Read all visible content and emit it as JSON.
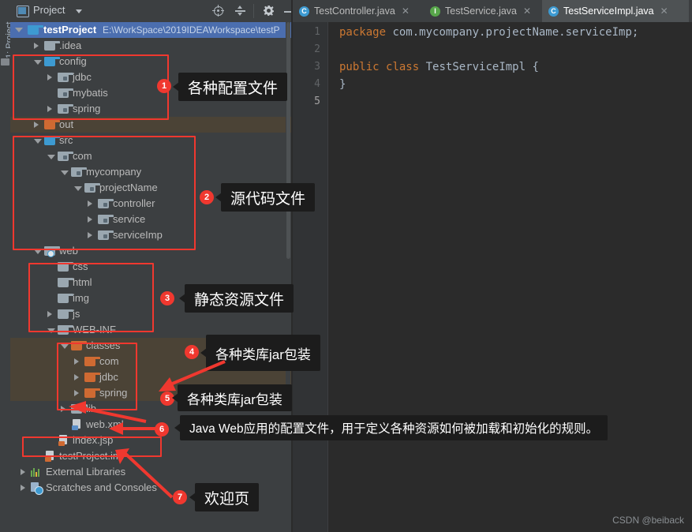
{
  "window": {
    "tool_strip_label": "1: Project"
  },
  "project_panel": {
    "title": "Project",
    "toolbar": [
      {
        "name": "locate-icon",
        "label": "Select Opened File"
      },
      {
        "name": "collapse-all-icon",
        "label": "Collapse All"
      },
      {
        "name": "gear-icon",
        "label": "Settings"
      },
      {
        "name": "minimize-icon",
        "label": "Hide"
      }
    ],
    "root": {
      "label": "testProject",
      "path": "E:\\WorkSpace\\2019IDEAWorkspace\\testP"
    },
    "tree": [
      {
        "label": ".idea",
        "depth": 1,
        "icon": "folder-gray",
        "arrow": "closed"
      },
      {
        "label": "config",
        "depth": 1,
        "icon": "folder-blue",
        "arrow": "open"
      },
      {
        "label": "jdbc",
        "depth": 2,
        "icon": "folder-package",
        "arrow": "closed"
      },
      {
        "label": "mybatis",
        "depth": 2,
        "icon": "folder-package",
        "arrow": "none"
      },
      {
        "label": "spring",
        "depth": 2,
        "icon": "folder-package",
        "arrow": "closed"
      },
      {
        "label": "out",
        "depth": 1,
        "icon": "folder-orange",
        "arrow": "closed"
      },
      {
        "label": "src",
        "depth": 1,
        "icon": "folder-blue",
        "arrow": "open"
      },
      {
        "label": "com",
        "depth": 2,
        "icon": "folder-package",
        "arrow": "open"
      },
      {
        "label": "mycompany",
        "depth": 3,
        "icon": "folder-package",
        "arrow": "open"
      },
      {
        "label": "projectName",
        "depth": 4,
        "icon": "folder-package",
        "arrow": "open"
      },
      {
        "label": "controller",
        "depth": 5,
        "icon": "folder-package",
        "arrow": "closed"
      },
      {
        "label": "service",
        "depth": 5,
        "icon": "folder-package",
        "arrow": "closed"
      },
      {
        "label": "serviceImp",
        "depth": 5,
        "icon": "folder-package",
        "arrow": "closed"
      },
      {
        "label": "web",
        "depth": 1,
        "icon": "folder-web",
        "arrow": "open"
      },
      {
        "label": "css",
        "depth": 2,
        "icon": "folder-gray",
        "arrow": "none"
      },
      {
        "label": "html",
        "depth": 2,
        "icon": "folder-gray",
        "arrow": "none"
      },
      {
        "label": "img",
        "depth": 2,
        "icon": "folder-gray",
        "arrow": "none"
      },
      {
        "label": "js",
        "depth": 2,
        "icon": "folder-gray",
        "arrow": "closed"
      },
      {
        "label": "WEB-INF",
        "depth": 2,
        "icon": "folder-gray",
        "arrow": "open"
      },
      {
        "label": "classes",
        "depth": 3,
        "icon": "folder-orange",
        "arrow": "open"
      },
      {
        "label": "com",
        "depth": 4,
        "icon": "folder-orange",
        "arrow": "closed"
      },
      {
        "label": "jdbc",
        "depth": 4,
        "icon": "folder-orange",
        "arrow": "closed"
      },
      {
        "label": "spring",
        "depth": 4,
        "icon": "folder-orange",
        "arrow": "closed"
      },
      {
        "label": "lib",
        "depth": 3,
        "icon": "folder-gray",
        "arrow": "closed"
      },
      {
        "label": "web.xml",
        "depth": 3,
        "icon": "file-xml",
        "arrow": "none"
      },
      {
        "label": "index.jsp",
        "depth": 2,
        "icon": "file-jsp",
        "arrow": "none"
      },
      {
        "label": "testProject.iml",
        "depth": 1,
        "icon": "file-iml",
        "arrow": "none"
      },
      {
        "label": "External Libraries",
        "depth": 0,
        "icon": "libraries",
        "arrow": "closed"
      },
      {
        "label": "Scratches and Consoles",
        "depth": 0,
        "icon": "scratches",
        "arrow": "closed"
      }
    ]
  },
  "annotations": {
    "accent_color": "#f0382f",
    "items": [
      {
        "number": "1",
        "text": "各种配置文件"
      },
      {
        "number": "2",
        "text": "源代码文件"
      },
      {
        "number": "3",
        "text": "静态资源文件"
      },
      {
        "number": "4",
        "text": "各种类库jar包装"
      },
      {
        "number": "5",
        "text": "各种类库jar包装"
      },
      {
        "number": "6",
        "text": "Java Web应用的配置文件，用于定义各种资源如何被加载和初始化的规则。"
      },
      {
        "number": "7",
        "text": "欢迎页"
      }
    ]
  },
  "editor": {
    "tabs": [
      {
        "label": "TestController.java",
        "icon": "class-icon",
        "icon_letter": "C",
        "active": false,
        "close": "✕"
      },
      {
        "label": "TestService.java",
        "icon": "interface-icon",
        "icon_letter": "I",
        "active": false,
        "close": "✕"
      },
      {
        "label": "TestServiceImpl.java",
        "icon": "class-icon",
        "icon_letter": "C",
        "active": true,
        "close": "✕"
      }
    ],
    "line_numbers": [
      "1",
      "2",
      "3",
      "4",
      "5"
    ],
    "current_line": "5",
    "code_lines": [
      {
        "segments": [
          {
            "t": "package",
            "c": "kw"
          },
          {
            "t": " com.mycompany.projectName.serviceImp;",
            "c": "pl"
          }
        ]
      },
      {
        "segments": []
      },
      {
        "segments": [
          {
            "t": "public",
            "c": "kw"
          },
          {
            "t": " ",
            "c": "pl"
          },
          {
            "t": "class",
            "c": "kw"
          },
          {
            "t": " TestServiceImpl ",
            "c": "cls"
          },
          {
            "t": "{",
            "c": "br"
          }
        ]
      },
      {
        "segments": [
          {
            "t": "}",
            "c": "br"
          }
        ]
      },
      {
        "segments": []
      }
    ]
  },
  "watermark": "CSDN @beiback"
}
